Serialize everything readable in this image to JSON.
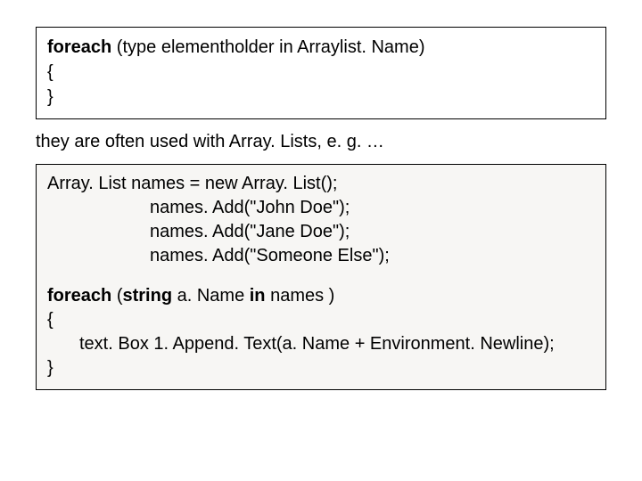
{
  "box1": {
    "line1_kw": "foreach",
    "line1_args": "  (type elementholder in Arraylist. Name)",
    "line2": "{",
    "line3": "}"
  },
  "desc": "they are often used with Array. Lists, e. g. …",
  "box2": {
    "l1": "Array. List names = new Array. List();",
    "l2": "names. Add(\"John Doe\");",
    "l3": "names. Add(\"Jane Doe\");",
    "l4": "names. Add(\"Someone Else\");",
    "fe_kw": "foreach ",
    "fe_open": "(",
    "fe_type": "string",
    "fe_mid": " a. Name ",
    "fe_in": "in",
    "fe_rest": " names )",
    "brace_open": "{",
    "body": "text. Box 1. Append. Text(a. Name + Environment. Newline);",
    "brace_close": "}"
  }
}
